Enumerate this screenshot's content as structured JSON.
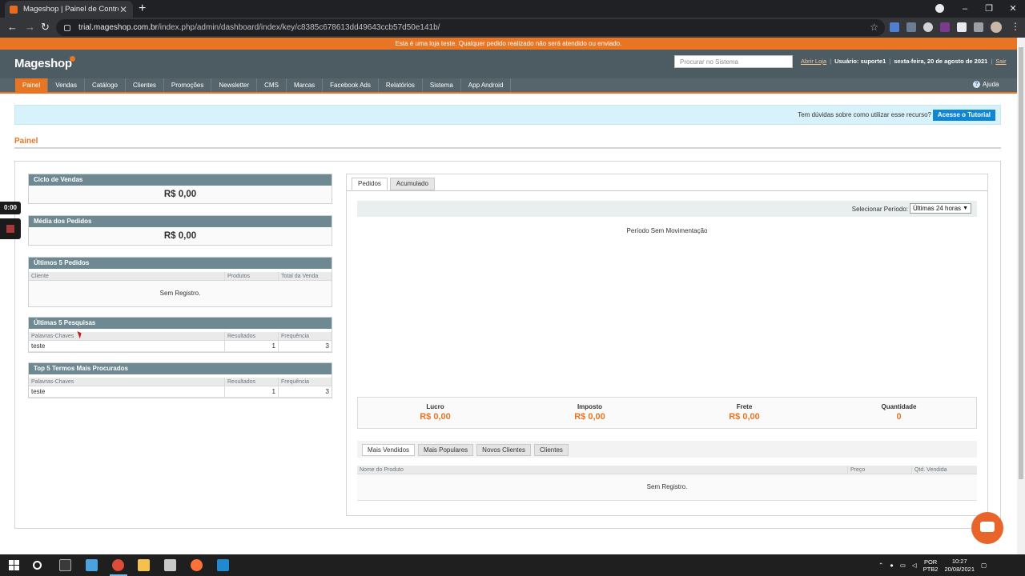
{
  "browser": {
    "tab_title": "Mageshop | Painel de Controle /",
    "tab_close": "✕",
    "new_tab": "+",
    "url_host": "trial.mageshop.com.br",
    "url_path": "/index.php/admin/dashboard/index/key/c8385c678613dd49643ccb57d50e141b/"
  },
  "notice": "Esta é uma loja teste. Qualquer pedido realizado não será atendido ou enviado.",
  "header": {
    "logo": "Mageshop",
    "search_placeholder": "Procurar no Sistema",
    "open_store": "Abrir Loja",
    "user": "Usuário: suporte1",
    "date": "sexta-feira, 20 de agosto de 2021",
    "logout": "Sair"
  },
  "nav": {
    "items": [
      "Painel",
      "Vendas",
      "Catálogo",
      "Clientes",
      "Promoções",
      "Newsletter",
      "CMS",
      "Marcas",
      "Facebook Ads",
      "Relatórios",
      "Sistema",
      "App Android"
    ],
    "help": "Ajuda"
  },
  "tutorial": {
    "text": "Tem dúvidas sobre como utilizar esse recurso?",
    "button": "Acesse o Tutorial"
  },
  "page_title": "Painel",
  "widgets": {
    "sales_cycle": {
      "title": "Ciclo de Vendas",
      "value": "R$ 0,00"
    },
    "avg_orders": {
      "title": "Média dos Pedidos",
      "value": "R$ 0,00"
    },
    "last_orders": {
      "title": "Últimos 5 Pedidos",
      "columns": [
        "Cliente",
        "Produtos",
        "Total da Venda"
      ],
      "empty": "Sem Registro."
    },
    "last_searches": {
      "title": "Últimas 5 Pesquisas",
      "columns": [
        "Palavras-Chaves",
        "Resultados",
        "Frequência"
      ],
      "rows": [
        {
          "keyword": "teste",
          "results": "1",
          "frequency": "3"
        }
      ]
    },
    "top_terms": {
      "title": "Top 5 Termos Mais Procurados",
      "columns": [
        "Palavras-Chaves",
        "Resultados",
        "Frequência"
      ],
      "rows": [
        {
          "keyword": "teste",
          "results": "1",
          "frequency": "3"
        }
      ]
    }
  },
  "chart_panel": {
    "tabs": [
      "Pedidos",
      "Acumulado"
    ],
    "period_label": "Selecionar Período:",
    "period_value": "Últimas 24 horas",
    "no_movement": "Período Sem Movimentação",
    "totals": [
      {
        "label": "Lucro",
        "value": "R$ 0,00"
      },
      {
        "label": "Imposto",
        "value": "R$ 0,00"
      },
      {
        "label": "Frete",
        "value": "R$ 0,00"
      },
      {
        "label": "Quantidade",
        "value": "0"
      }
    ],
    "bottom_tabs": [
      "Mais Vendidos",
      "Mais Populares",
      "Novos Clientes",
      "Clientes"
    ],
    "product_columns": [
      "Nome do Produto",
      "Preço",
      "Qtd. Vendida"
    ],
    "product_empty": "Sem Registro."
  },
  "overlay": {
    "timer": "0:00"
  },
  "taskbar": {
    "lang_top": "POR",
    "lang_bottom": "PTB2",
    "time": "10:27",
    "date": "20/08/2021"
  },
  "colors": {
    "accent": "#e87524",
    "header": "#4d5b62",
    "nav": "#56656c",
    "widget_head": "#6f8992",
    "tutorial_bg": "#d8f2fb",
    "tutorial_button": "#0e86d4"
  }
}
